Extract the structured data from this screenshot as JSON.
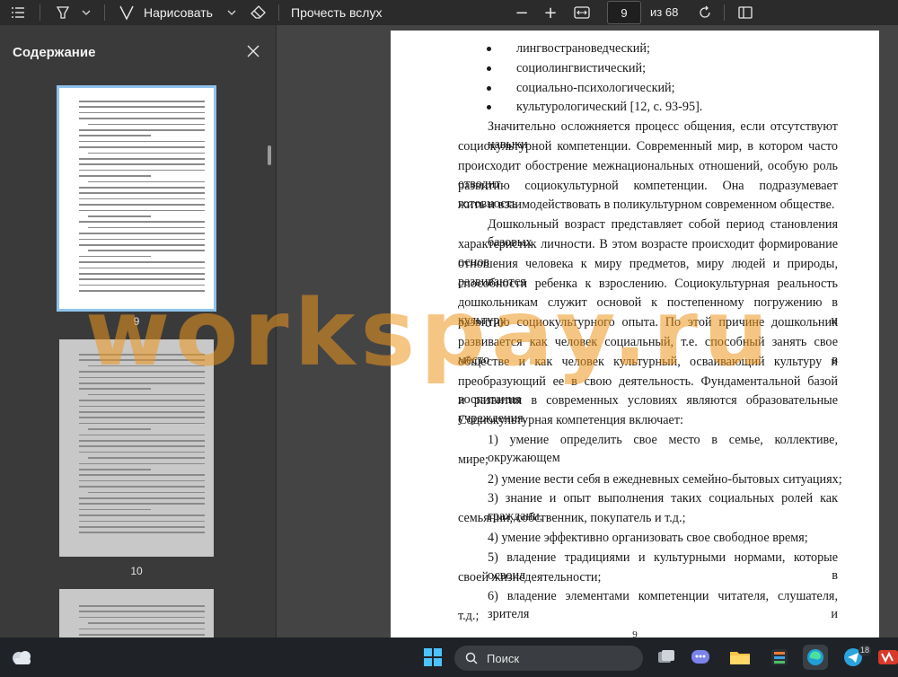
{
  "toolbar": {
    "draw_label": "Нарисовать",
    "read_aloud_label": "Прочесть вслух",
    "current_page": "9",
    "total_pages": "из 68",
    "zoom_out": "−",
    "zoom_in": "+"
  },
  "sidebar": {
    "title": "Содержание",
    "thumbnails": [
      {
        "label": "9"
      },
      {
        "label": "10"
      }
    ]
  },
  "document": {
    "bullets": [
      "лингвострановедческий;",
      "социолингвистический;",
      "социально-психологический;",
      "культурологический [12, с. 93-95]."
    ],
    "lines": [
      "Значительно осложняется процесс общения, если отсутствуют навыки",
      "социокультурной компетенции. Современный мир, в котором часто",
      "происходит обострение межнациональных отношений, особую роль отводит",
      "развитию социокультурной компетенции. Она подразумевает готовность",
      "жить и взаимодействовать в поликультурном современном обществе.",
      "Дошкольный возраст представляет собой период становления базовых",
      "характеристик личности. В этом возрасте происходит формирование основ",
      "отношения человека к миру предметов, миру людей и природы, развиваются",
      "способности ребенка к взрослению. Социокультурная реальность",
      "дошкольникам служит основой к постепенному погружению в культуру и",
      "развитию социокультурного опыта. По этой причине дошкольник",
      "развивается как человек социальный, т.е. способный занять свое место в",
      "обществе и как человек культурный, осваивающий культуру и",
      "преобразующий ее в свою деятельность. Фундаментальной базой воспитания",
      "и развития в современных условиях являются образовательные учреждения.",
      "Социокультурная компетенция включает:",
      "1) умение определить свое место в семье, коллективе, окружающем",
      "мире;",
      "2) умение вести себя в ежедневных семейно-бытовых ситуациях;",
      "3) знание и опыт выполнения таких социальных ролей как граждани,",
      "семьянин, собственник, покупатель и т.д.;",
      "4) умение эффективно организовать свое свободное время;",
      "5) владение традициями и культурными нормами, которые освоил в",
      "своей жизнедеятельности;",
      "6) владение элементами компетенции читателя, слушателя, зрителя и",
      "т.д.;"
    ],
    "page_number": "9"
  },
  "watermark": "workspay.ru",
  "taskbar": {
    "search_label": "Поиск",
    "telegram_badge": "18"
  },
  "colors": {
    "toolbar_bg": "#2b2b2b",
    "sidebar_bg": "#3a3a3a",
    "selected_thumb_border": "#8fc3ee",
    "watermark": "#ec961e",
    "taskbar_bg": "#1f2327"
  }
}
